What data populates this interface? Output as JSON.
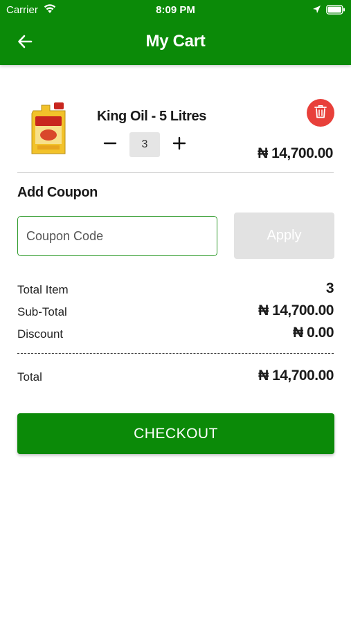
{
  "status_bar": {
    "carrier": "Carrier",
    "time": "8:09 PM"
  },
  "header": {
    "title": "My Cart",
    "back_icon": "arrow-left-icon",
    "color": "#0b8a08"
  },
  "cart_item": {
    "name": "King Oil - 5 Litres",
    "quantity": "3",
    "price": "₦ 14,700.00",
    "image_icon": "oil-jerrycan-image",
    "delete_icon": "trash-icon",
    "delete_color": "#e8403a",
    "minus_icon": "minus-icon",
    "plus_icon": "plus-icon"
  },
  "coupon": {
    "heading": "Add Coupon",
    "placeholder": "Coupon Code",
    "value": "",
    "apply_label": "Apply"
  },
  "summary": {
    "total_item_label": "Total Item",
    "total_item_value": "3",
    "subtotal_label": "Sub-Total",
    "subtotal_value": "₦ 14,700.00",
    "discount_label": "Discount",
    "discount_value": "₦ 0.00",
    "total_label": "Total",
    "total_value": "₦ 14,700.00"
  },
  "checkout": {
    "label": "CHECKOUT"
  }
}
